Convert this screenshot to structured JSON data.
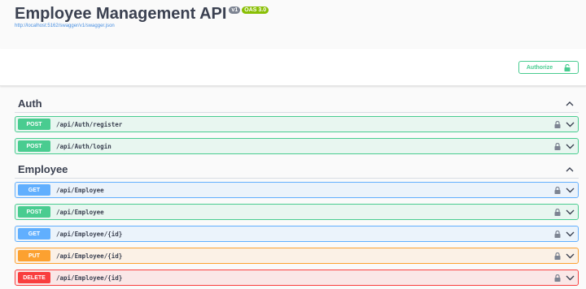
{
  "info": {
    "title": "Employee Management API",
    "version": "v1",
    "oas": "OAS 3.0",
    "url": "http://localhost:5162/swagger/v1/swagger.json"
  },
  "authorize_label": "Authorize",
  "colors": {
    "post": "#49cc90",
    "get": "#61affe",
    "put": "#fca130",
    "delete": "#f93e3e"
  },
  "sections": [
    {
      "title": "Auth",
      "operations": [
        {
          "method": "POST",
          "path": "/api/Auth/register"
        },
        {
          "method": "POST",
          "path": "/api/Auth/login"
        }
      ]
    },
    {
      "title": "Employee",
      "operations": [
        {
          "method": "GET",
          "path": "/api/Employee"
        },
        {
          "method": "POST",
          "path": "/api/Employee"
        },
        {
          "method": "GET",
          "path": "/api/Employee/{id}"
        },
        {
          "method": "PUT",
          "path": "/api/Employee/{id}"
        },
        {
          "method": "DELETE",
          "path": "/api/Employee/{id}"
        }
      ]
    }
  ]
}
